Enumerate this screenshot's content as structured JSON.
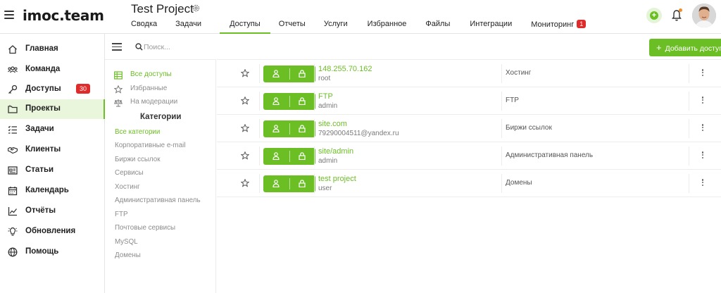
{
  "header": {
    "logo": "imoc.team",
    "project_title": "Test Project",
    "tabs": [
      {
        "label": "Сводка"
      },
      {
        "label": "Задачи"
      },
      {
        "label": "Доступы"
      },
      {
        "label": "Отчеты"
      },
      {
        "label": "Услуги"
      },
      {
        "label": "Избранное"
      },
      {
        "label": "Файлы"
      },
      {
        "label": "Интеграции"
      },
      {
        "label": "Мониторинг",
        "badge": "1"
      }
    ],
    "active_tab": "Доступы"
  },
  "sidebar": {
    "items": [
      {
        "label": "Главная",
        "icon": "home-icon"
      },
      {
        "label": "Команда",
        "icon": "team-icon"
      },
      {
        "label": "Доступы",
        "icon": "key-icon",
        "badge": "30"
      },
      {
        "label": "Проекты",
        "icon": "folder-icon"
      },
      {
        "label": "Задачи",
        "icon": "tasks-icon"
      },
      {
        "label": "Клиенты",
        "icon": "handshake-icon"
      },
      {
        "label": "Статьи",
        "icon": "article-icon"
      },
      {
        "label": "Календарь",
        "icon": "calendar-icon"
      },
      {
        "label": "Отчёты",
        "icon": "chart-icon"
      },
      {
        "label": "Обновления",
        "icon": "bulb-icon"
      },
      {
        "label": "Помощь",
        "icon": "globe-icon"
      }
    ],
    "active_item": "Проекты"
  },
  "toolbar": {
    "search_placeholder": "Поиск...",
    "add_button_label": "Добавить доступ"
  },
  "filters": [
    {
      "label": "Все доступы",
      "icon": "table-icon"
    },
    {
      "label": "Избранные",
      "icon": "star-icon"
    },
    {
      "label": "На модерации",
      "icon": "scales-icon"
    }
  ],
  "categories": {
    "heading": "Категории",
    "items": [
      "Все категории",
      "Корпоративные e-mail",
      "Биржи ссылок",
      "Сервисы",
      "Хостинг",
      "Административная панель",
      "FTP",
      "Почтовые сервисы",
      "MySQL",
      "Домены"
    ]
  },
  "accesses": [
    {
      "title": "148.255.70.162",
      "login": "root",
      "category": "Хостинг"
    },
    {
      "title": "FTP",
      "login": "admin",
      "category": "FTP"
    },
    {
      "title": "site.com",
      "login": "79290004511@yandex.ru",
      "category": "Биржи ссылок"
    },
    {
      "title": "site/admin",
      "login": "admin",
      "category": "Административная панель"
    },
    {
      "title": "test project",
      "login": "user",
      "category": "Домены"
    }
  ],
  "colors": {
    "accent": "#6cbe25",
    "badge": "#e02b2b",
    "notification_dot": "#f28c28"
  }
}
